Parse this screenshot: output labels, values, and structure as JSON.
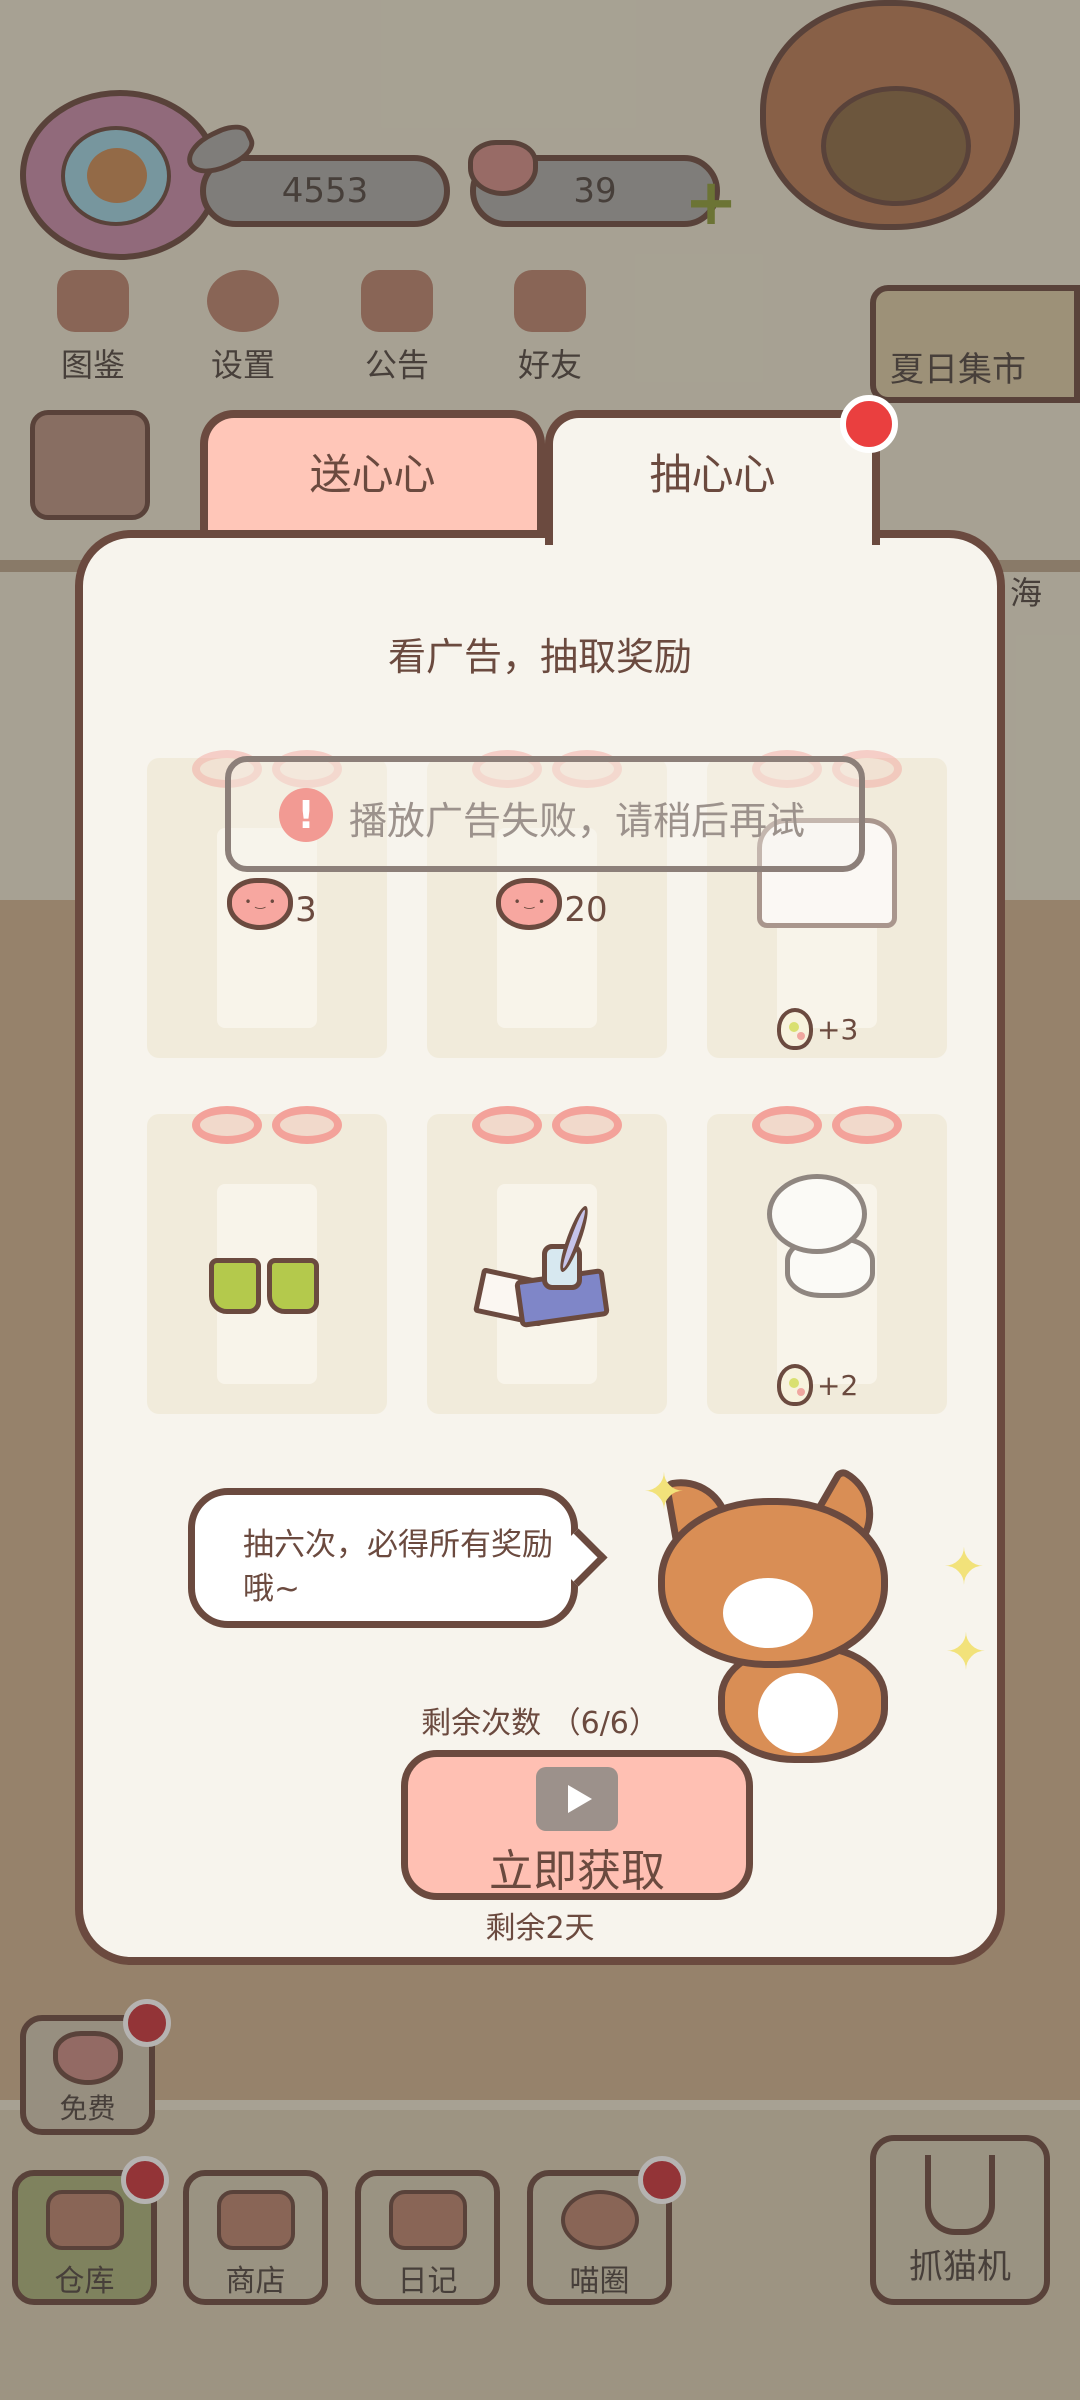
{
  "hud": {
    "fish_count": "4553",
    "heart_count": "39",
    "menu": [
      {
        "label": "图鉴",
        "icon": "cat-book-icon"
      },
      {
        "label": "设置",
        "icon": "gear-icon"
      },
      {
        "label": "公告",
        "icon": "gift-icon"
      },
      {
        "label": "好友",
        "icon": "friends-icon"
      }
    ],
    "market_label": "夏日集市",
    "right_edge_text": "海"
  },
  "modal": {
    "tabs": {
      "send": "送心心",
      "draw": "抽心心"
    },
    "title": "看广告，抽取奖励",
    "toast": "播放广告失败，请稍后再试",
    "rewards": [
      {
        "icon": "heart-icon",
        "amount": "3"
      },
      {
        "icon": "heart-icon",
        "amount": "20"
      },
      {
        "icon": "shirt-icon",
        "bonus": "+3"
      },
      {
        "icon": "boots-icon"
      },
      {
        "icon": "ink-quill-icon"
      },
      {
        "icon": "white-cat-icon",
        "bonus": "+2"
      }
    ],
    "bubble_text": "抽六次，必得所有奖励哦~",
    "remaining_text": "剩余次数 （6/6）",
    "get_button": "立即获取",
    "days_left": "剩余2天"
  },
  "bottom": {
    "free_label": "免费",
    "nav": [
      {
        "label": "仓库",
        "icon": "warehouse-icon"
      },
      {
        "label": "商店",
        "icon": "shop-icon"
      },
      {
        "label": "日记",
        "icon": "diary-icon"
      },
      {
        "label": "喵圈",
        "icon": "planet-cat-icon"
      }
    ],
    "claw_label": "抓猫机"
  },
  "colors": {
    "outline": "#6b4a3f",
    "tab_active": "#ffc6b8",
    "modal_bg": "#f7f4ed",
    "notify_red": "#ea3f3f",
    "button_pink": "#ffc0b3"
  }
}
